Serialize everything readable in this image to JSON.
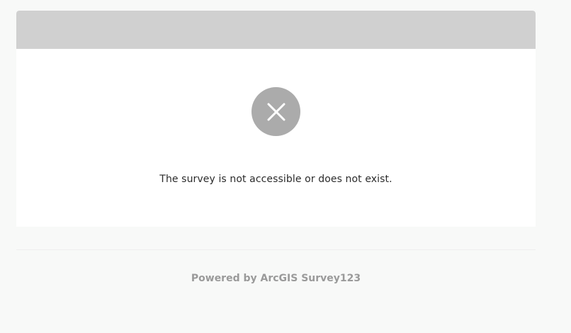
{
  "message": {
    "text": "The survey is not accessible or does not exist.",
    "icon": "close-icon"
  },
  "footer": {
    "text": "Powered by ArcGIS Survey123"
  },
  "colors": {
    "background": "#f8f9f8",
    "header_bar": "#d0d0d0",
    "icon_circle": "#ababab",
    "message_text": "#2b2b2b",
    "footer_text": "#9a9a9a"
  }
}
